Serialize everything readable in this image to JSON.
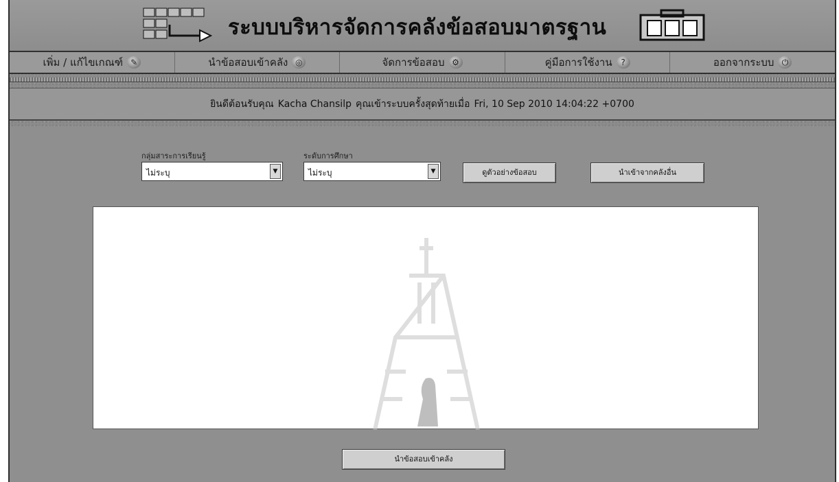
{
  "app": {
    "title": "ระบบบริหารจัดการคลังข้อสอบมาตรฐาน"
  },
  "menu": {
    "items": [
      {
        "label": "เพิ่ม / แก้ไขเกณฑ์",
        "icon": "pencil-icon"
      },
      {
        "label": "นำข้อสอบเข้าคลัง",
        "icon": "globe-icon"
      },
      {
        "label": "จัดการข้อสอบ",
        "icon": "gear-icon"
      },
      {
        "label": "คู่มือการใช้งาน",
        "icon": "help-icon"
      },
      {
        "label": "ออกจากระบบ",
        "icon": "power-icon"
      }
    ]
  },
  "welcome": {
    "greeting": "ยินดีต้อนรับคุณ",
    "user_name": "Kacha Chansilp",
    "last_login_label": "คุณเข้าระบบครั้งสุดท้ายเมื่อ",
    "last_login_time": "Fri, 10 Sep 2010 14:04:22 +0700"
  },
  "filters": {
    "subject_label": "กลุ่มสาระการเรียนรู้",
    "subject_value": "ไม่ระบุ",
    "level_label": "ระดับการศึกษา",
    "level_value": "ไม่ระบุ"
  },
  "buttons": {
    "preview": "ดูตัวอย่างข้อสอบ",
    "import_other": "นำเข้าจากคลังอื่น",
    "import_to_bank": "นำข้อสอบเข้าคลัง"
  },
  "colors": {
    "background": "#8f8f8f",
    "panel": "#ffffff",
    "button": "#cfcfcf"
  }
}
